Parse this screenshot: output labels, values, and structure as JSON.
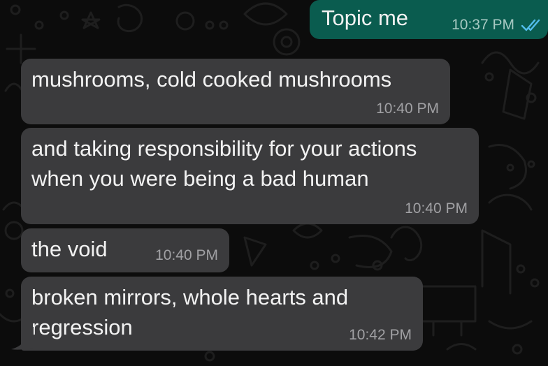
{
  "messages": [
    {
      "direction": "outgoing",
      "text": "Topic me",
      "time": "10:37 PM",
      "status": "read"
    },
    {
      "direction": "incoming",
      "text": "mushrooms, cold cooked mushrooms",
      "time": "10:40 PM"
    },
    {
      "direction": "incoming",
      "text": "and taking responsibility for your actions\nwhen you were being a bad human",
      "time": "10:40 PM"
    },
    {
      "direction": "incoming",
      "text": "the void",
      "time": "10:40 PM"
    },
    {
      "direction": "incoming",
      "text": "broken mirrors, whole hearts and\nregression",
      "time": "10:42 PM"
    }
  ],
  "colors": {
    "background": "#0c0c0c",
    "incoming_bubble": "#3b3b3d",
    "outgoing_bubble": "#0a5c4f",
    "read_ticks": "#53bdeb"
  },
  "icons": {
    "read_receipt": "double-check-icon",
    "wallpaper": "doodle-wallpaper"
  }
}
